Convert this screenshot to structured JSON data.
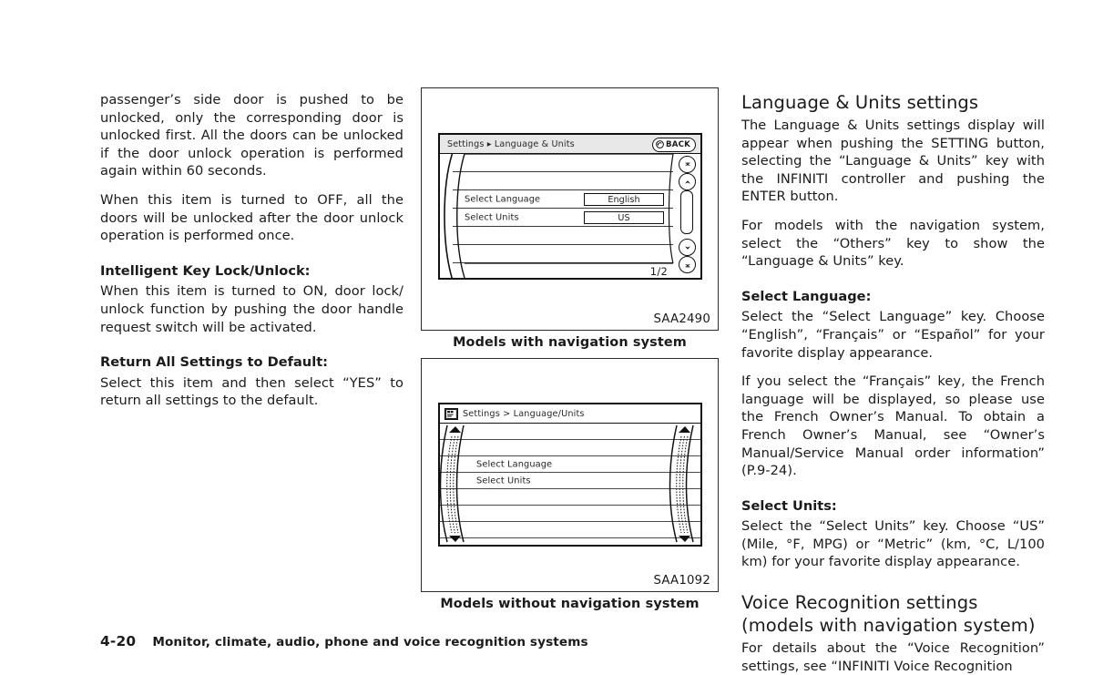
{
  "left_column": {
    "paragraphs": [
      "passenger’s side door is pushed to be unlocked, only the corresponding door is unlocked first. All the doors can be unlocked if the door unlock operation is performed again within 60 seconds.",
      "When this item is turned to OFF, all the doors will be unlocked after the door unlock operation is performed once."
    ],
    "section_intelligent_key": {
      "heading": "Intelligent Key Lock/Unlock:",
      "body": "When this item is turned to ON, door lock/ unlock function by pushing the door handle request switch will be activated."
    },
    "section_return_defaults": {
      "heading": "Return All Settings to Default:",
      "body": "Select this item and then select “YES” to return all settings to the default."
    }
  },
  "figure_nav": {
    "image_id": "SAA2490",
    "caption": "Models with navigation system",
    "screen": {
      "breadcrumb": "Settings ▸ Language & Units",
      "back_label": "BACK",
      "page_indicator": "1/2",
      "rows": [
        {
          "label": "",
          "value": ""
        },
        {
          "label": "",
          "value": ""
        },
        {
          "label": "Select Language",
          "value": "English"
        },
        {
          "label": "Select Units",
          "value": "US"
        },
        {
          "label": "",
          "value": ""
        },
        {
          "label": "",
          "value": ""
        }
      ]
    }
  },
  "figure_plain": {
    "image_id": "SAA1092",
    "caption": "Models without navigation system",
    "screen": {
      "breadcrumb": "Settings > Language/Units",
      "rows": [
        {
          "label": ""
        },
        {
          "label": ""
        },
        {
          "label": "Select Language"
        },
        {
          "label": "Select Units"
        },
        {
          "label": ""
        },
        {
          "label": ""
        },
        {
          "label": ""
        }
      ]
    }
  },
  "right_column": {
    "heading_language_units": "Language & Units settings",
    "paragraphs": [
      "The Language & Units settings display will appear when pushing the SETTING button, selecting the “Language & Units” key with the INFINITI controller and pushing the ENTER button.",
      "For models with the navigation system, select the “Others” key to show the “Language & Units” key."
    ],
    "section_select_language": {
      "heading": "Select Language:",
      "body1": "Select the “Select Language” key. Choose “English”, “Français” or “Español” for your favorite display appearance.",
      "body2": "If you select the “Français” key, the French language will be displayed, so please use the French Owner’s Manual. To obtain a French Owner’s Manual, see “Owner’s Manual/Service Manual order information” (P.9-24)."
    },
    "section_select_units": {
      "heading": "Select Units:",
      "body": "Select the “Select Units” key. Choose “US” (Mile, °F, MPG) or “Metric” (km, °C, L/100 km) for your favorite display appearance."
    },
    "heading_voice_recognition": "Voice Recognition settings (models with navigation system)",
    "voice_body": "For details about the “Voice Recognition” settings, see “INFINITI Voice Recognition"
  },
  "footer": {
    "page_number": "4-20",
    "title": "Monitor, climate, audio, phone and voice recognition systems"
  }
}
